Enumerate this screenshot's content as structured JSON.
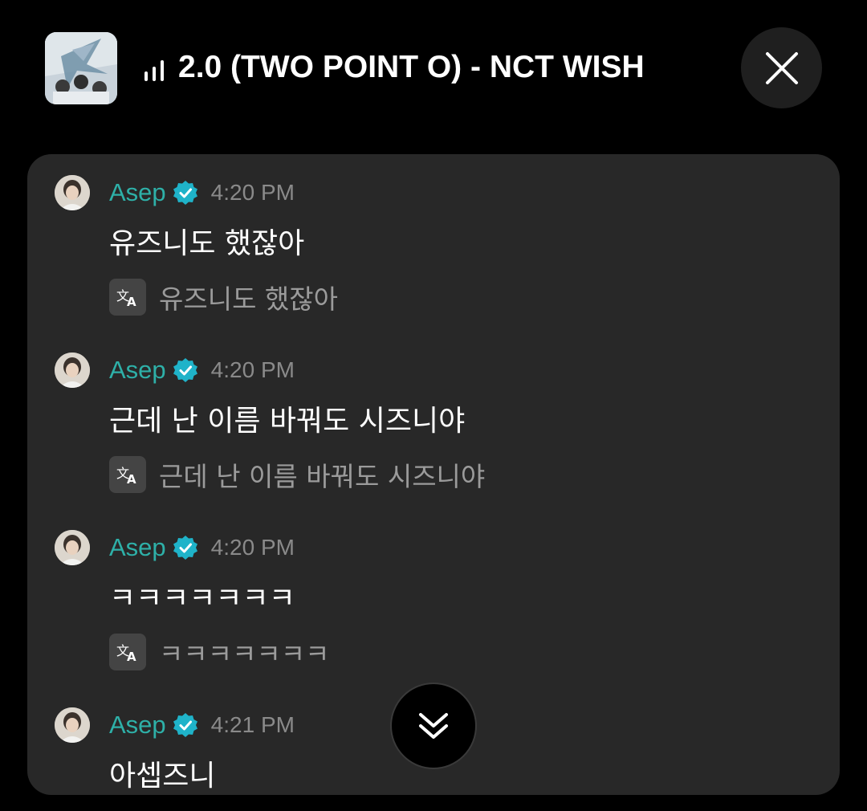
{
  "header": {
    "album_art_icon": "album-cover-image",
    "playing_icon": "equalizer-bars-icon",
    "song_title": "2.0 (TWO POINT O) - NCT WISH",
    "close_icon": "close-x-icon"
  },
  "colors": {
    "background": "#000000",
    "panel": "#282828",
    "username": "#2eb0a8",
    "verified_badge": "#1fb3c9",
    "timestamp": "#8a8a8a",
    "translation_text": "#9b9b9b"
  },
  "messages": [
    {
      "username": "Asep",
      "verified": true,
      "time": "4:20 PM",
      "text": "유즈니도 했잖아",
      "translation": "유즈니도 했잖아"
    },
    {
      "username": "Asep",
      "verified": true,
      "time": "4:20 PM",
      "text": "근데 난 이름 바꿔도 시즈니야",
      "translation": "근데 난 이름 바꿔도 시즈니야"
    },
    {
      "username": "Asep",
      "verified": true,
      "time": "4:20 PM",
      "text": "ㅋㅋㅋㅋㅋㅋㅋ",
      "translation": "ㅋㅋㅋㅋㅋㅋㅋ"
    },
    {
      "username": "Asep",
      "verified": true,
      "time": "4:21 PM",
      "text": "아셉즈니"
    }
  ],
  "scroll_down_icon": "double-chevron-down-icon"
}
